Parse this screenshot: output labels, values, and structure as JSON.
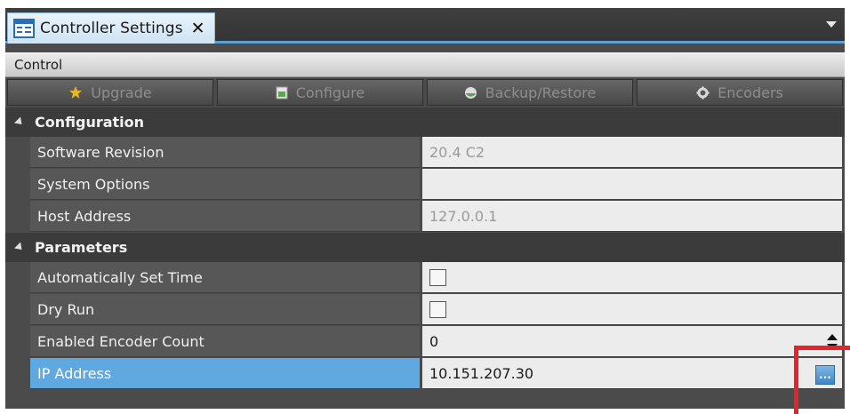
{
  "tab": {
    "title": "Controller Settings",
    "close_glyph": "✕"
  },
  "control_bar": {
    "label": "Control"
  },
  "actions": [
    {
      "label": "Upgrade",
      "icon": "star-icon"
    },
    {
      "label": "Configure",
      "icon": "configure-icon"
    },
    {
      "label": "Backup/Restore",
      "icon": "backup-restore-icon"
    },
    {
      "label": "Encoders",
      "icon": "gear-icon"
    }
  ],
  "groups": {
    "configuration": {
      "label": "Configuration",
      "properties": [
        {
          "name": "Software Revision",
          "value": "20.4 C2"
        },
        {
          "name": "System Options",
          "value": ""
        },
        {
          "name": "Host Address",
          "value": "127.0.0.1"
        }
      ]
    },
    "parameters": {
      "label": "Parameters",
      "properties": [
        {
          "name": "Automatically Set Time",
          "checked": false
        },
        {
          "name": "Dry Run",
          "checked": false
        },
        {
          "name": "Enabled Encoder Count",
          "value": "0"
        },
        {
          "name": "IP Address",
          "value": "10.151.207.30",
          "selected": true,
          "ellipsis": "..."
        }
      ]
    }
  },
  "colors": {
    "accent": "#5fa8e0",
    "highlight": "#e4232a",
    "panel": "#4b4b4b"
  }
}
